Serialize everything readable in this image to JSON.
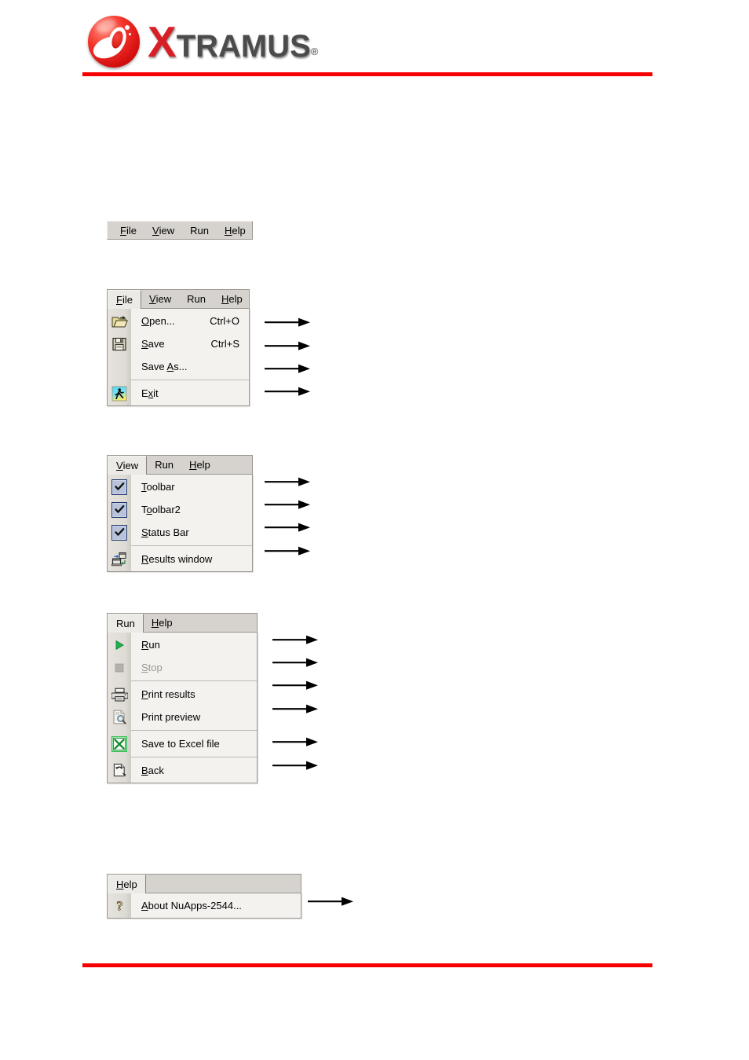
{
  "brand": {
    "name_x": "X",
    "name_rest": "TRAMUS",
    "registered": "®",
    "accent_color": "#d81f26",
    "rule_color": "#f80000"
  },
  "menubar_strip": {
    "items": [
      {
        "label": "File",
        "accel": "F",
        "active": false
      },
      {
        "label": "View",
        "accel": "V",
        "active": false
      },
      {
        "label": "Run",
        "accel": "",
        "active": false
      },
      {
        "label": "Help",
        "accel": "H",
        "active": false
      }
    ]
  },
  "file_menu": {
    "menubar": [
      {
        "label": "File",
        "accel": "F",
        "active": true
      },
      {
        "label": "View",
        "accel": "V",
        "active": false
      },
      {
        "label": "Run",
        "accel": "",
        "active": false
      },
      {
        "label": "Help",
        "accel": "H",
        "active": false
      }
    ],
    "items": [
      {
        "label": "Open...",
        "accel": "O",
        "shortcut": "Ctrl+O",
        "icon": "open-folder-icon",
        "disabled": false,
        "separator_after": false
      },
      {
        "label": "Save",
        "accel": "S",
        "shortcut": "Ctrl+S",
        "icon": "floppy-disk-icon",
        "disabled": false,
        "separator_after": false
      },
      {
        "label": "Save As...",
        "accel": "A",
        "shortcut": "",
        "icon": "none",
        "disabled": false,
        "separator_after": true
      },
      {
        "label": "Exit",
        "accel": "x",
        "shortcut": "",
        "icon": "exit-person-icon",
        "disabled": false,
        "separator_after": false
      }
    ],
    "arrow_count": 4
  },
  "view_menu": {
    "menubar": [
      {
        "label": "View",
        "accel": "V",
        "active": true
      },
      {
        "label": "Run",
        "accel": "",
        "active": false
      },
      {
        "label": "Help",
        "accel": "H",
        "active": false
      }
    ],
    "items": [
      {
        "label": "Toolbar",
        "accel": "T",
        "icon": "checkbox-checked-icon",
        "checked": true,
        "separator_after": false
      },
      {
        "label": "Toolbar2",
        "accel": "o",
        "icon": "checkbox-checked-icon",
        "checked": true,
        "separator_after": false
      },
      {
        "label": "Status Bar",
        "accel": "S",
        "icon": "checkbox-checked-icon",
        "checked": true,
        "separator_after": true
      },
      {
        "label": "Results window",
        "accel": "R",
        "icon": "results-window-icon",
        "checked": false,
        "separator_after": false
      }
    ],
    "arrow_count": 4
  },
  "run_menu": {
    "menubar": [
      {
        "label": "Run",
        "accel": "",
        "active": true
      },
      {
        "label": "Help",
        "accel": "H",
        "active": false
      }
    ],
    "items": [
      {
        "label": "Run",
        "accel": "R",
        "icon": "play-triangle-icon",
        "disabled": false,
        "separator_after": false
      },
      {
        "label": "Stop",
        "accel": "S",
        "icon": "stop-square-icon",
        "disabled": true,
        "separator_after": true
      },
      {
        "label": "Print results",
        "accel": "P",
        "icon": "printer-icon",
        "disabled": false,
        "separator_after": false
      },
      {
        "label": "Print preview",
        "accel": "",
        "icon": "print-preview-icon",
        "disabled": false,
        "separator_after": true
      },
      {
        "label": "Save to Excel file",
        "accel": "",
        "icon": "excel-icon",
        "disabled": false,
        "separator_after": true
      },
      {
        "label": "Back",
        "accel": "B",
        "icon": "back-page-icon",
        "disabled": false,
        "separator_after": false
      }
    ],
    "arrow_count": 6
  },
  "help_menu": {
    "menubar": [
      {
        "label": "Help",
        "accel": "H",
        "active": true
      }
    ],
    "items": [
      {
        "label": "About NuApps-2544...",
        "accel": "A",
        "icon": "question-mark-icon",
        "disabled": false,
        "separator_after": false
      }
    ],
    "arrow_count": 1
  }
}
